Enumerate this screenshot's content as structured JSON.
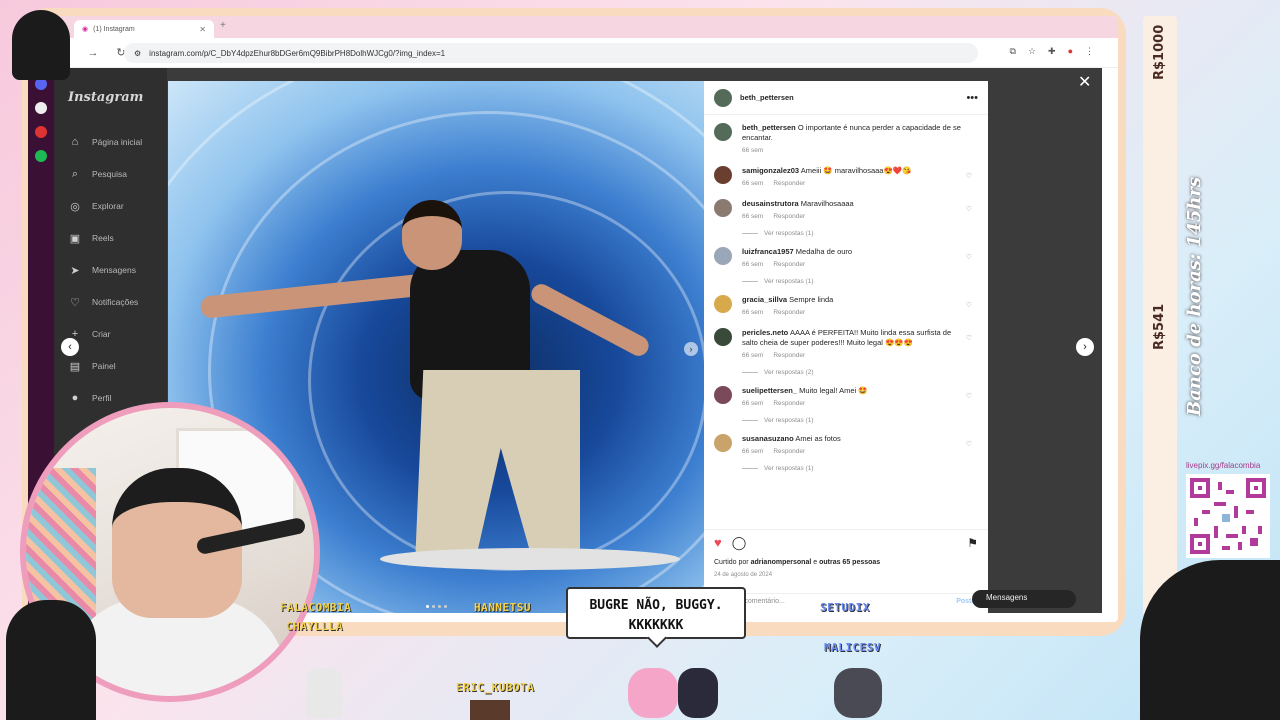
{
  "browser": {
    "tab_title": "(1) Instagram",
    "url": "instagram.com/p/C_DbY4dpzEhur8bDGer6mQ9BibrPH8DolhWJCg0/?img_index=1"
  },
  "instagram": {
    "logo": "Instagram",
    "nav": [
      {
        "label": "Página inicial",
        "icon": "home-icon"
      },
      {
        "label": "Pesquisa",
        "icon": "search-icon"
      },
      {
        "label": "Explorar",
        "icon": "compass-icon"
      },
      {
        "label": "Reels",
        "icon": "reels-icon"
      },
      {
        "label": "Mensagens",
        "icon": "messages-icon"
      },
      {
        "label": "Notificações",
        "icon": "heart-icon"
      },
      {
        "label": "Criar",
        "icon": "plus-icon"
      },
      {
        "label": "Painel",
        "icon": "dashboard-icon"
      },
      {
        "label": "Perfil",
        "icon": "profile-icon"
      }
    ],
    "messages_pill": "Mensagens"
  },
  "post": {
    "author": "beth_pettersen",
    "caption_user": "beth_pettersen",
    "caption": "O importante é nunca perder a capacidade de se encantar.",
    "caption_age": "66 sem",
    "comments": [
      {
        "user": "samigonzalez03",
        "text": "Ameiii 🤩 maravilhosaaa😍❤️😘",
        "age": "66 sem",
        "reply": "Responder",
        "replies": ""
      },
      {
        "user": "deusainstrutora",
        "text": "Maravilhosaaaa",
        "age": "66 sem",
        "reply": "Responder",
        "replies": "Ver respostas (1)"
      },
      {
        "user": "luizfranca1957",
        "text": "Medalha de ouro",
        "age": "66 sem",
        "reply": "Responder",
        "replies": "Ver respostas (1)"
      },
      {
        "user": "gracia_sillva",
        "text": "Sempre linda",
        "age": "66 sem",
        "reply": "Responder",
        "replies": ""
      },
      {
        "user": "pericles.neto",
        "text": "AAAA é PERFEITA!! Muito linda essa surfista de salto cheia de super poderes!!! Muito legal 😍😍😍",
        "age": "66 sem",
        "reply": "Responder",
        "replies": "Ver respostas (2)"
      },
      {
        "user": "suelipettersen_",
        "text": "Muito legal! Amei 🤩",
        "age": "66 sem",
        "reply": "Responder",
        "replies": "Ver respostas (1)"
      },
      {
        "user": "susanasuzano",
        "text": "Amei as fotos",
        "age": "66 sem",
        "reply": "Responder",
        "replies": "Ver respostas (1)"
      }
    ],
    "liked_by_prefix": "Curtido por",
    "liked_by_user": "adrianompersonal",
    "liked_by_suffix": "e",
    "liked_others": "outras 65 pessoas",
    "date": "24 de agosto de 2024",
    "add_comment_placeholder": "cione um comentário...",
    "post_button": "Postar"
  },
  "stream": {
    "goal_top": "R$1000",
    "goal_bottom": "R$541",
    "bank_hours": "Banco de horas: 145hrs",
    "qr_label": "livepix.gg/falacombia",
    "usernames": [
      {
        "name": "FALACOMBIA",
        "color": "#f2d24a"
      },
      {
        "name": "CHAYLLLA",
        "color": "#f2d24a"
      },
      {
        "name": "HANNETSU",
        "color": "#f2d24a"
      },
      {
        "name": "SETUDIX",
        "color": "#6b8cf0"
      },
      {
        "name": "MALICESV",
        "color": "#6b8cf0"
      },
      {
        "name": "ERIC_KUBOTA",
        "color": "#f2d24a"
      }
    ],
    "chat_bubble_line1": "BUGRE NÃO, BUGGY.",
    "chat_bubble_line2": "KKKKKKK"
  }
}
